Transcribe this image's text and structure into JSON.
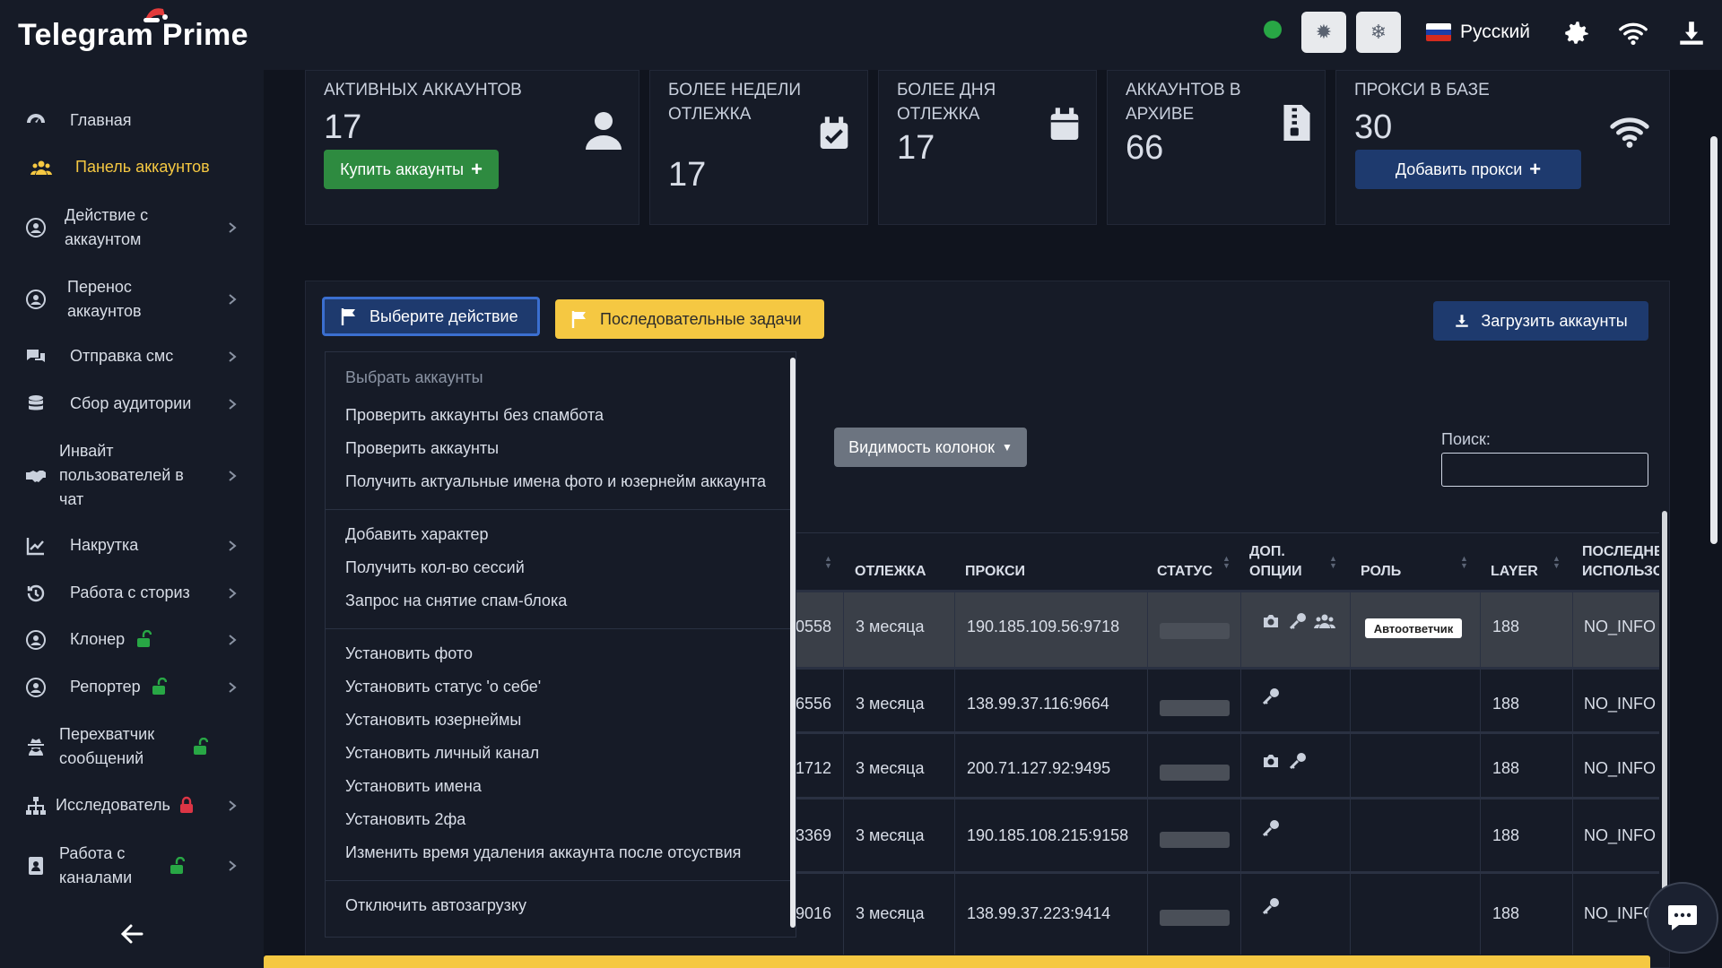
{
  "app": {
    "brand": "Telegram Prime"
  },
  "topbar": {
    "language": "Русский"
  },
  "sidebar": {
    "items": [
      {
        "label": "Главная"
      },
      {
        "label": "Панель аккаунтов"
      },
      {
        "label": "Действие с аккаунтом"
      },
      {
        "label": "Перенос аккаунтов"
      },
      {
        "label": "Отправка смс"
      },
      {
        "label": "Сбор аудитории"
      },
      {
        "label": "Инвайт пользователей в чат"
      },
      {
        "label": "Накрутка"
      },
      {
        "label": "Работа с сториз"
      },
      {
        "label": "Клонер"
      },
      {
        "label": "Репортер"
      },
      {
        "label": "Перехватчик сообщений"
      },
      {
        "label": "Исследователь"
      },
      {
        "label": "Работа с каналами"
      }
    ]
  },
  "stats": {
    "active": {
      "label": "Активных аккаунтов",
      "value": "17",
      "button": "Купить аккаунты"
    },
    "week": {
      "label": "Более недели отлежка",
      "value": "17"
    },
    "day": {
      "label": "Более дня отлежка",
      "value": "17"
    },
    "archive": {
      "label": "Аккаунтов в архиве",
      "value": "66"
    },
    "proxy": {
      "label": "Прокси в базе",
      "value": "30",
      "button": "Добавить прокси"
    }
  },
  "toolbar": {
    "action": "Выберите действие",
    "tasks": "Последовательные задачи",
    "upload": "Загрузить аккаунты",
    "columns": "Видимость колонок",
    "search_label": "Поиск:"
  },
  "dropdown": {
    "header": "Выбрать аккаунты",
    "items": [
      "Проверить аккаунты без спамбота",
      "Проверить аккаунты",
      "Получить актуальные имена фото и юзернейм аккаунта",
      "Добавить характер",
      "Получить кол-во сессий",
      "Запрос на снятие спам-блока",
      "Установить фото",
      "Установить статус 'о себе'",
      "Установить юзернеймы",
      "Установить личный канал",
      "Установить имена",
      "Установить 2фа",
      "Изменить время удаления аккаунта после отсуствия",
      "Отключить автозагрузку"
    ]
  },
  "table": {
    "headers": {
      "rest": "Отлежка",
      "proxy": "Прокси",
      "status": "Статус",
      "options": "Доп. опции",
      "role": "Роль",
      "layer": "Layer",
      "last": "Последне использо"
    },
    "rows": [
      {
        "id": "0558",
        "rest": "3 месяца",
        "proxy": "190.185.109.56:9718",
        "role": "Автоответчик",
        "layer": "188",
        "last": "NO_INFO"
      },
      {
        "id": "6556",
        "rest": "3 месяца",
        "proxy": "138.99.37.116:9664",
        "role": "",
        "layer": "188",
        "last": "NO_INFO"
      },
      {
        "id": "1712",
        "rest": "3 месяца",
        "proxy": "200.71.127.92:9495",
        "role": "",
        "layer": "188",
        "last": "NO_INFO"
      },
      {
        "id": "3369",
        "rest": "3 месяца",
        "proxy": "190.185.108.215:9158",
        "role": "",
        "layer": "188",
        "last": "NO_INFO"
      },
      {
        "id": "9016",
        "rest": "3 месяца",
        "proxy": "138.99.37.223:9414",
        "role": "",
        "layer": "188",
        "last": "NO_INFO"
      }
    ]
  },
  "colors": {
    "accent_yellow": "#f5c842",
    "primary_blue": "#1e3a6e",
    "green": "#28a745",
    "danger": "#dc3545"
  }
}
